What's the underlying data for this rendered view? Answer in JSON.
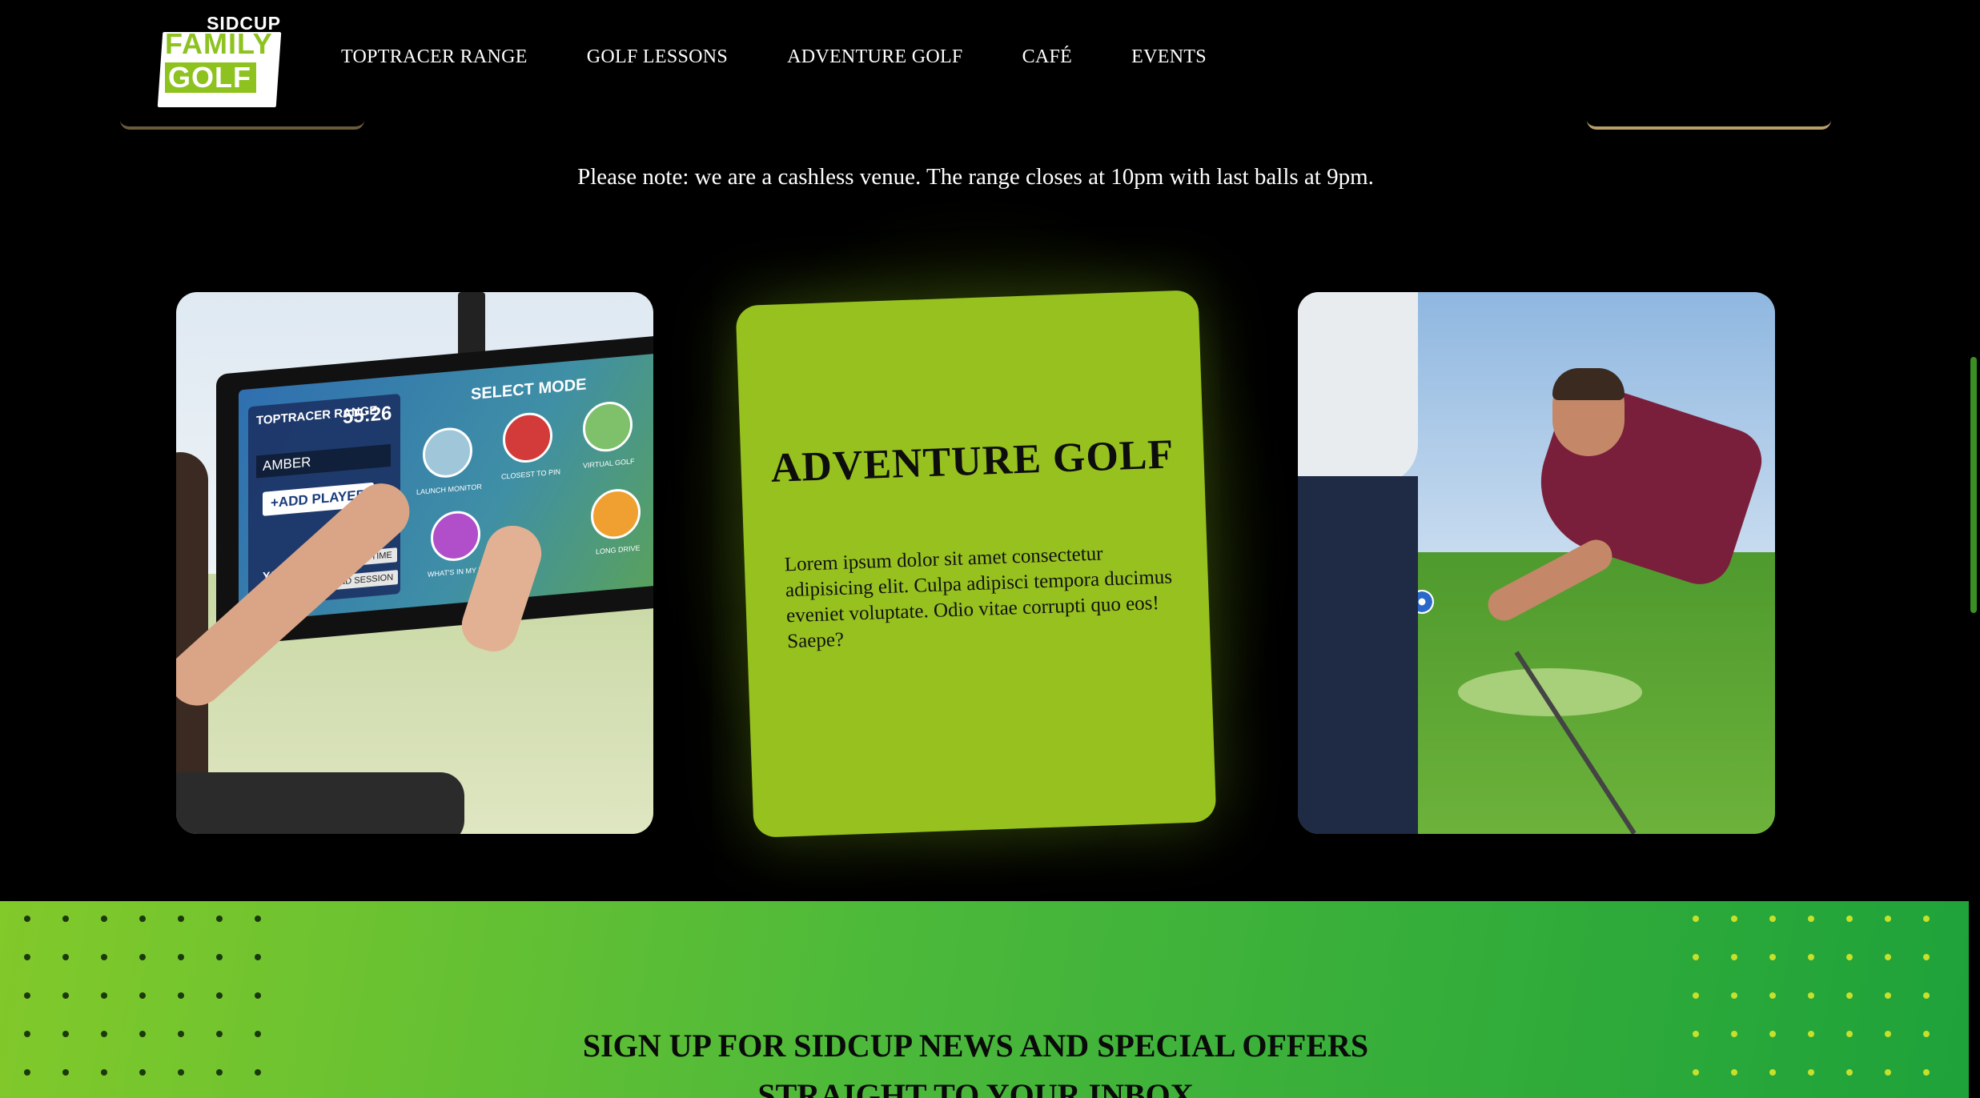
{
  "header": {
    "logo": {
      "top": "SIDCUP",
      "line1": "FAMILY",
      "line2": "GOLF"
    },
    "nav": [
      {
        "label": "TOPTRACER RANGE"
      },
      {
        "label": "GOLF LESSONS"
      },
      {
        "label": "ADVENTURE GOLF"
      },
      {
        "label": "CAFÉ"
      },
      {
        "label": "EVENTS"
      }
    ]
  },
  "notice": "Please note: we are a cashless venue. The range closes at 10pm with last balls at 9pm.",
  "cards": {
    "left_screen": {
      "brand": "TOPTRACER RANGE",
      "time": "55:26",
      "player": "AMBER",
      "add_player": "+ADD PLAYER",
      "select_mode": "SELECT MODE",
      "units": "YARDS",
      "extend": "EXTEND TIME",
      "end": "END SESSION",
      "modes": [
        "LAUNCH MONITOR",
        "CLOSEST TO PIN",
        "VIRTUAL GOLF",
        "WHAT'S IN MY BAG",
        "LONG DRIVE"
      ]
    },
    "feature": {
      "title": "ADVENTURE GOLF",
      "text": "Lorem ipsum dolor sit amet consectetur adipisicing elit. Culpa adipisci tempora ducimus eveniet voluptate. Odio vitae corrupti quo eos! Saepe?"
    }
  },
  "newsletter": {
    "line1": "SIGN UP FOR SIDCUP NEWS AND SPECIAL OFFERS",
    "line2": "STRAIGHT TO YOUR INBOX"
  },
  "colors": {
    "accent": "#96c11f",
    "background": "#000000",
    "newsletter_start": "#82c92a",
    "newsletter_end": "#1ea23a"
  }
}
